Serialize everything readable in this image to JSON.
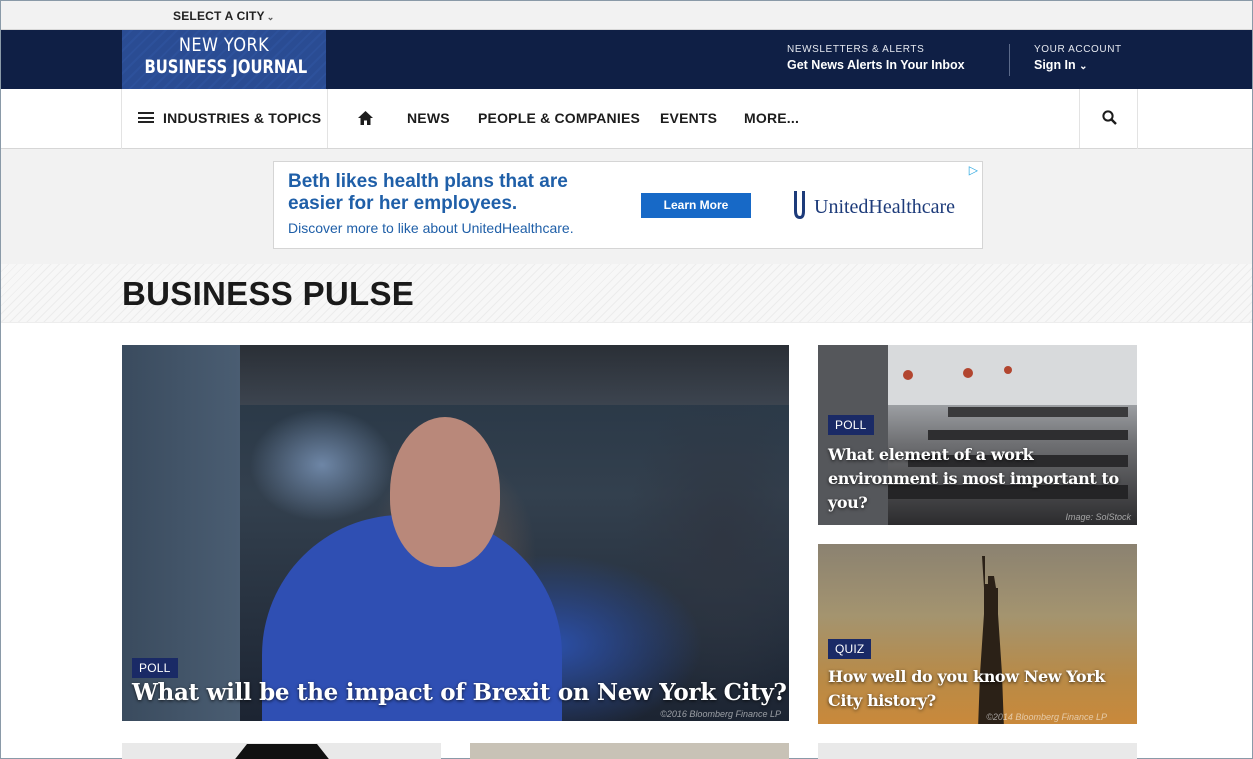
{
  "top_bar": {
    "city_select_label": "SELECT A CITY"
  },
  "masthead": {
    "logo_line1": "NEW YORK",
    "logo_line2": "BUSINESS JOURNAL",
    "newsletters_small": "NEWSLETTERS & ALERTS",
    "newsletters_big": "Get News Alerts In Your Inbox",
    "account_small": "YOUR ACCOUNT",
    "account_big": "Sign In"
  },
  "nav": {
    "industries": "INDUSTRIES & TOPICS",
    "items": [
      "NEWS",
      "PEOPLE & COMPANIES",
      "EVENTS",
      "MORE..."
    ]
  },
  "ad": {
    "line1": "Beth likes health plans that are",
    "line2": "easier for her employees.",
    "line3": "Discover more to like about UnitedHealthcare.",
    "button": "Learn More",
    "brand": "UnitedHealthcare"
  },
  "section": {
    "title": "BUSINESS PULSE"
  },
  "cards": [
    {
      "tag": "POLL",
      "headline": "What will be the impact of Brexit on New York City?",
      "credit": "©2016 Bloomberg Finance LP"
    },
    {
      "tag": "POLL",
      "headline": "What element of a work environment is most important to you?",
      "credit": "Image: SolStock"
    },
    {
      "tag": "QUIZ",
      "headline": "How well do you know New York City history?",
      "credit": "©2014 Bloomberg Finance LP"
    }
  ],
  "colors": {
    "masthead_bg": "#0f1f45",
    "tag_bg": "#1a2a66",
    "ad_text": "#1f5fa8"
  }
}
